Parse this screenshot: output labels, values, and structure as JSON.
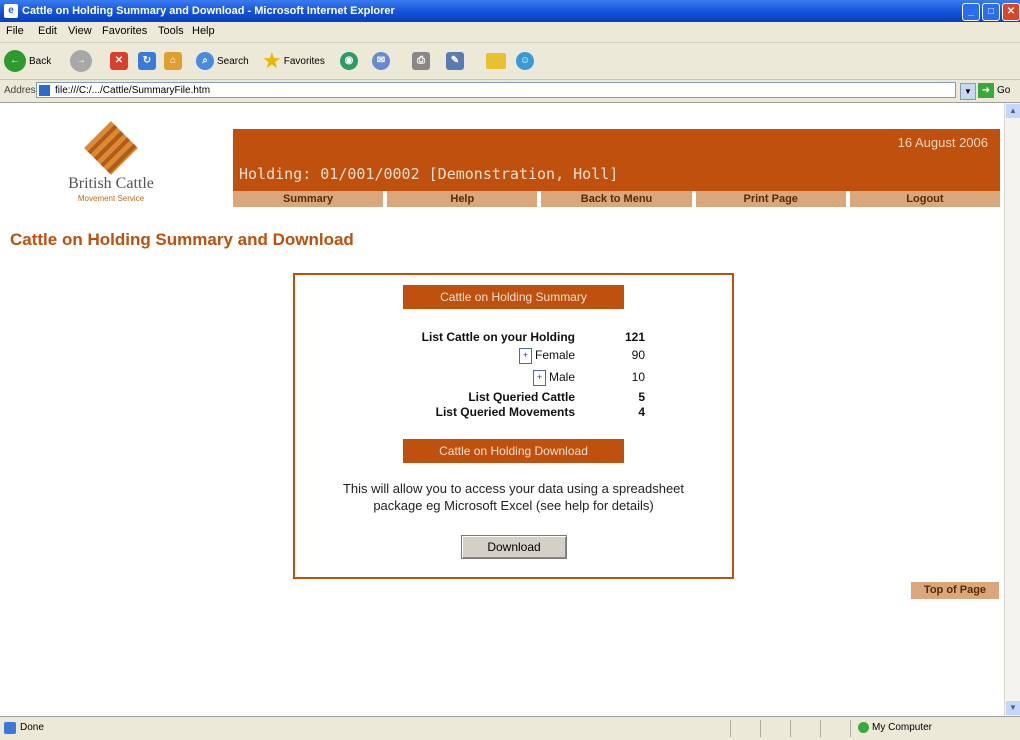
{
  "window": {
    "title": "Cattle on Holding Summary and Download - Microsoft Internet Explorer"
  },
  "menu": [
    "File",
    "Edit",
    "View",
    "Favorites",
    "Tools",
    "Help"
  ],
  "toolbar": {
    "back_label": "Back",
    "search_label": "Search",
    "favorites_label": "Favorites"
  },
  "address": {
    "label": "Address",
    "url": "file:///C:/.../Cattle/SummaryFile.htm",
    "go_label": "Go"
  },
  "logo": {
    "name": "British Cattle",
    "subtitle": "Movement Service"
  },
  "banner": {
    "date": "16 August 2006",
    "holding": "Holding: 01/001/0002 [Demonstration, Holl]"
  },
  "nav": [
    "Summary",
    "Help",
    "Back to Menu",
    "Print Page",
    "Logout"
  ],
  "page": {
    "heading": "Cattle on Holding Summary and Download"
  },
  "summary_panel": {
    "header": "Cattle on Holding Summary",
    "rows": [
      {
        "label": "List Cattle on your Holding",
        "value": "121",
        "expandable": false
      },
      {
        "label": "Female",
        "value": "90",
        "expandable": true
      },
      {
        "label": "Male",
        "value": "10",
        "expandable": true
      },
      {
        "label": "List Queried Cattle",
        "value": "5",
        "expandable": false
      },
      {
        "label": "List Queried Movements",
        "value": "4",
        "expandable": false
      }
    ]
  },
  "download_panel": {
    "header": "Cattle on Holding Download",
    "description_line1": "This will allow you to access your data using a spreadsheet",
    "description_line2": "package eg Microsoft Excel (see help for details)",
    "button_label": "Download"
  },
  "top_of_page_label": "Top of Page",
  "status": {
    "text": "Done",
    "zone": "My Computer"
  }
}
